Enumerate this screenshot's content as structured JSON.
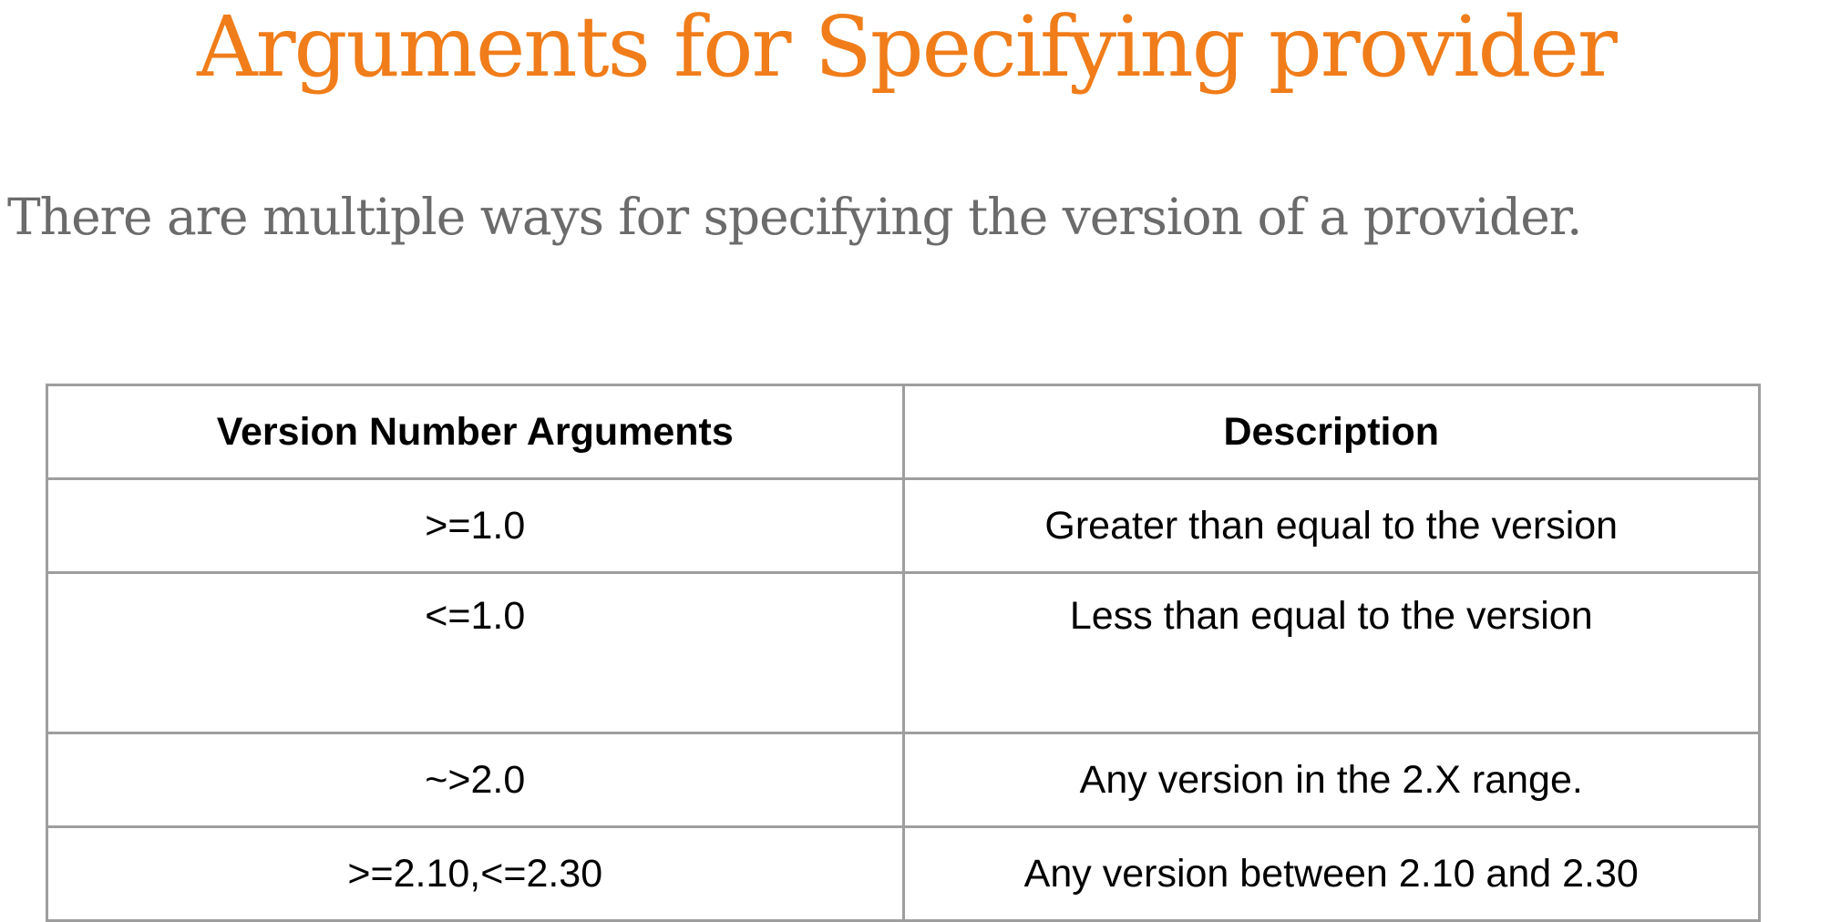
{
  "title": "Arguments for Specifying provider",
  "intro": "There are multiple ways for specifying the version of a provider.",
  "table": {
    "headers": [
      "Version Number Arguments",
      "Description"
    ],
    "rows": [
      {
        "argument": ">=1.0",
        "description": "Greater than equal to the version"
      },
      {
        "argument": "<=1.0",
        "description": "Less than equal to the version"
      },
      {
        "argument": "~>2.0",
        "description": "Any version in the 2.X range."
      },
      {
        "argument": ">=2.10,<=2.30",
        "description": "Any version between 2.10 and 2.30"
      }
    ]
  },
  "colors": {
    "title": "#f07d1a",
    "intro": "#6b6b6b",
    "table_border": "#9e9e9e"
  }
}
